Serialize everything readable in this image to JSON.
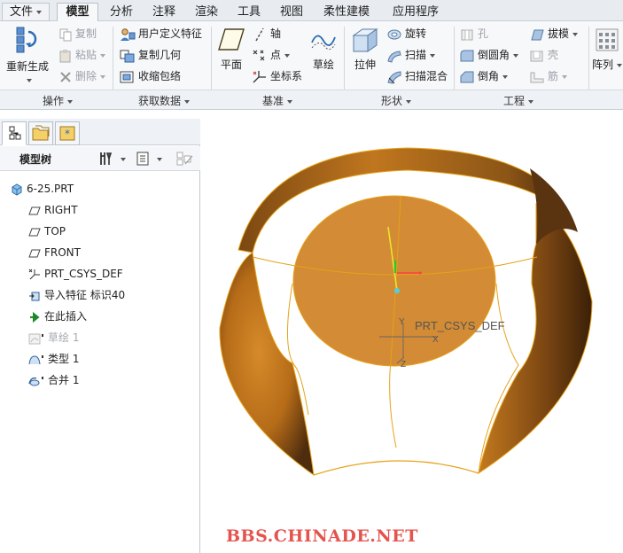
{
  "menubar": {
    "file_label": "文件",
    "tabs": [
      {
        "label": "模型",
        "active": true
      },
      {
        "label": "分析"
      },
      {
        "label": "注释"
      },
      {
        "label": "渲染"
      },
      {
        "label": "工具"
      },
      {
        "label": "视图"
      },
      {
        "label": "柔性建模"
      },
      {
        "label": "应用程序"
      }
    ]
  },
  "ribbon": {
    "operations": {
      "label": "操作",
      "regenerate": "重新生成",
      "copy": "复制",
      "paste": "粘贴",
      "delete": "删除"
    },
    "get_data": {
      "label": "获取数据",
      "udf": "用户定义特征",
      "copy_geom": "复制几何",
      "shrinkwrap": "收缩包络"
    },
    "datum": {
      "label": "基准",
      "plane": "平面",
      "axis": "轴",
      "point": "点",
      "csys": "坐标系",
      "sketch": "草绘"
    },
    "shapes": {
      "label": "形状",
      "extrude": "拉伸",
      "revolve": "旋转",
      "sweep": "扫描",
      "swept_blend": "扫描混合"
    },
    "engineering": {
      "label": "工程",
      "hole": "孔",
      "round": "倒圆角",
      "chamfer": "倒角",
      "draft": "拔模",
      "shell": "壳",
      "rib": "筋"
    },
    "pattern": {
      "label": "阵列"
    }
  },
  "model_tree": {
    "title": "模型树",
    "items": [
      {
        "label": "6-25.PRT",
        "icon": "part-icon"
      },
      {
        "label": "RIGHT",
        "icon": "datum-plane-icon"
      },
      {
        "label": "TOP",
        "icon": "datum-plane-icon"
      },
      {
        "label": "FRONT",
        "icon": "datum-plane-icon"
      },
      {
        "label": "PRT_CSYS_DEF",
        "icon": "csys-icon"
      },
      {
        "label": "导入特征 标识40",
        "icon": "import-feature-icon"
      },
      {
        "label": "在此插入",
        "icon": "insert-arrow-icon"
      },
      {
        "label": "草绘 1",
        "icon": "sketch-icon"
      },
      {
        "label": "类型 1",
        "icon": "surface-icon"
      },
      {
        "label": "合并 1",
        "icon": "merge-icon"
      }
    ]
  },
  "canvas": {
    "csys_label": "PRT_CSYS_DEF",
    "axis_x": "X",
    "axis_y": "Y",
    "axis_z": "Z"
  },
  "watermark": "BBS.CHINADE.NET",
  "colors": {
    "surface": "#c98522",
    "surface_dark": "#5a3410",
    "accent_blue": "#2e6db4"
  }
}
